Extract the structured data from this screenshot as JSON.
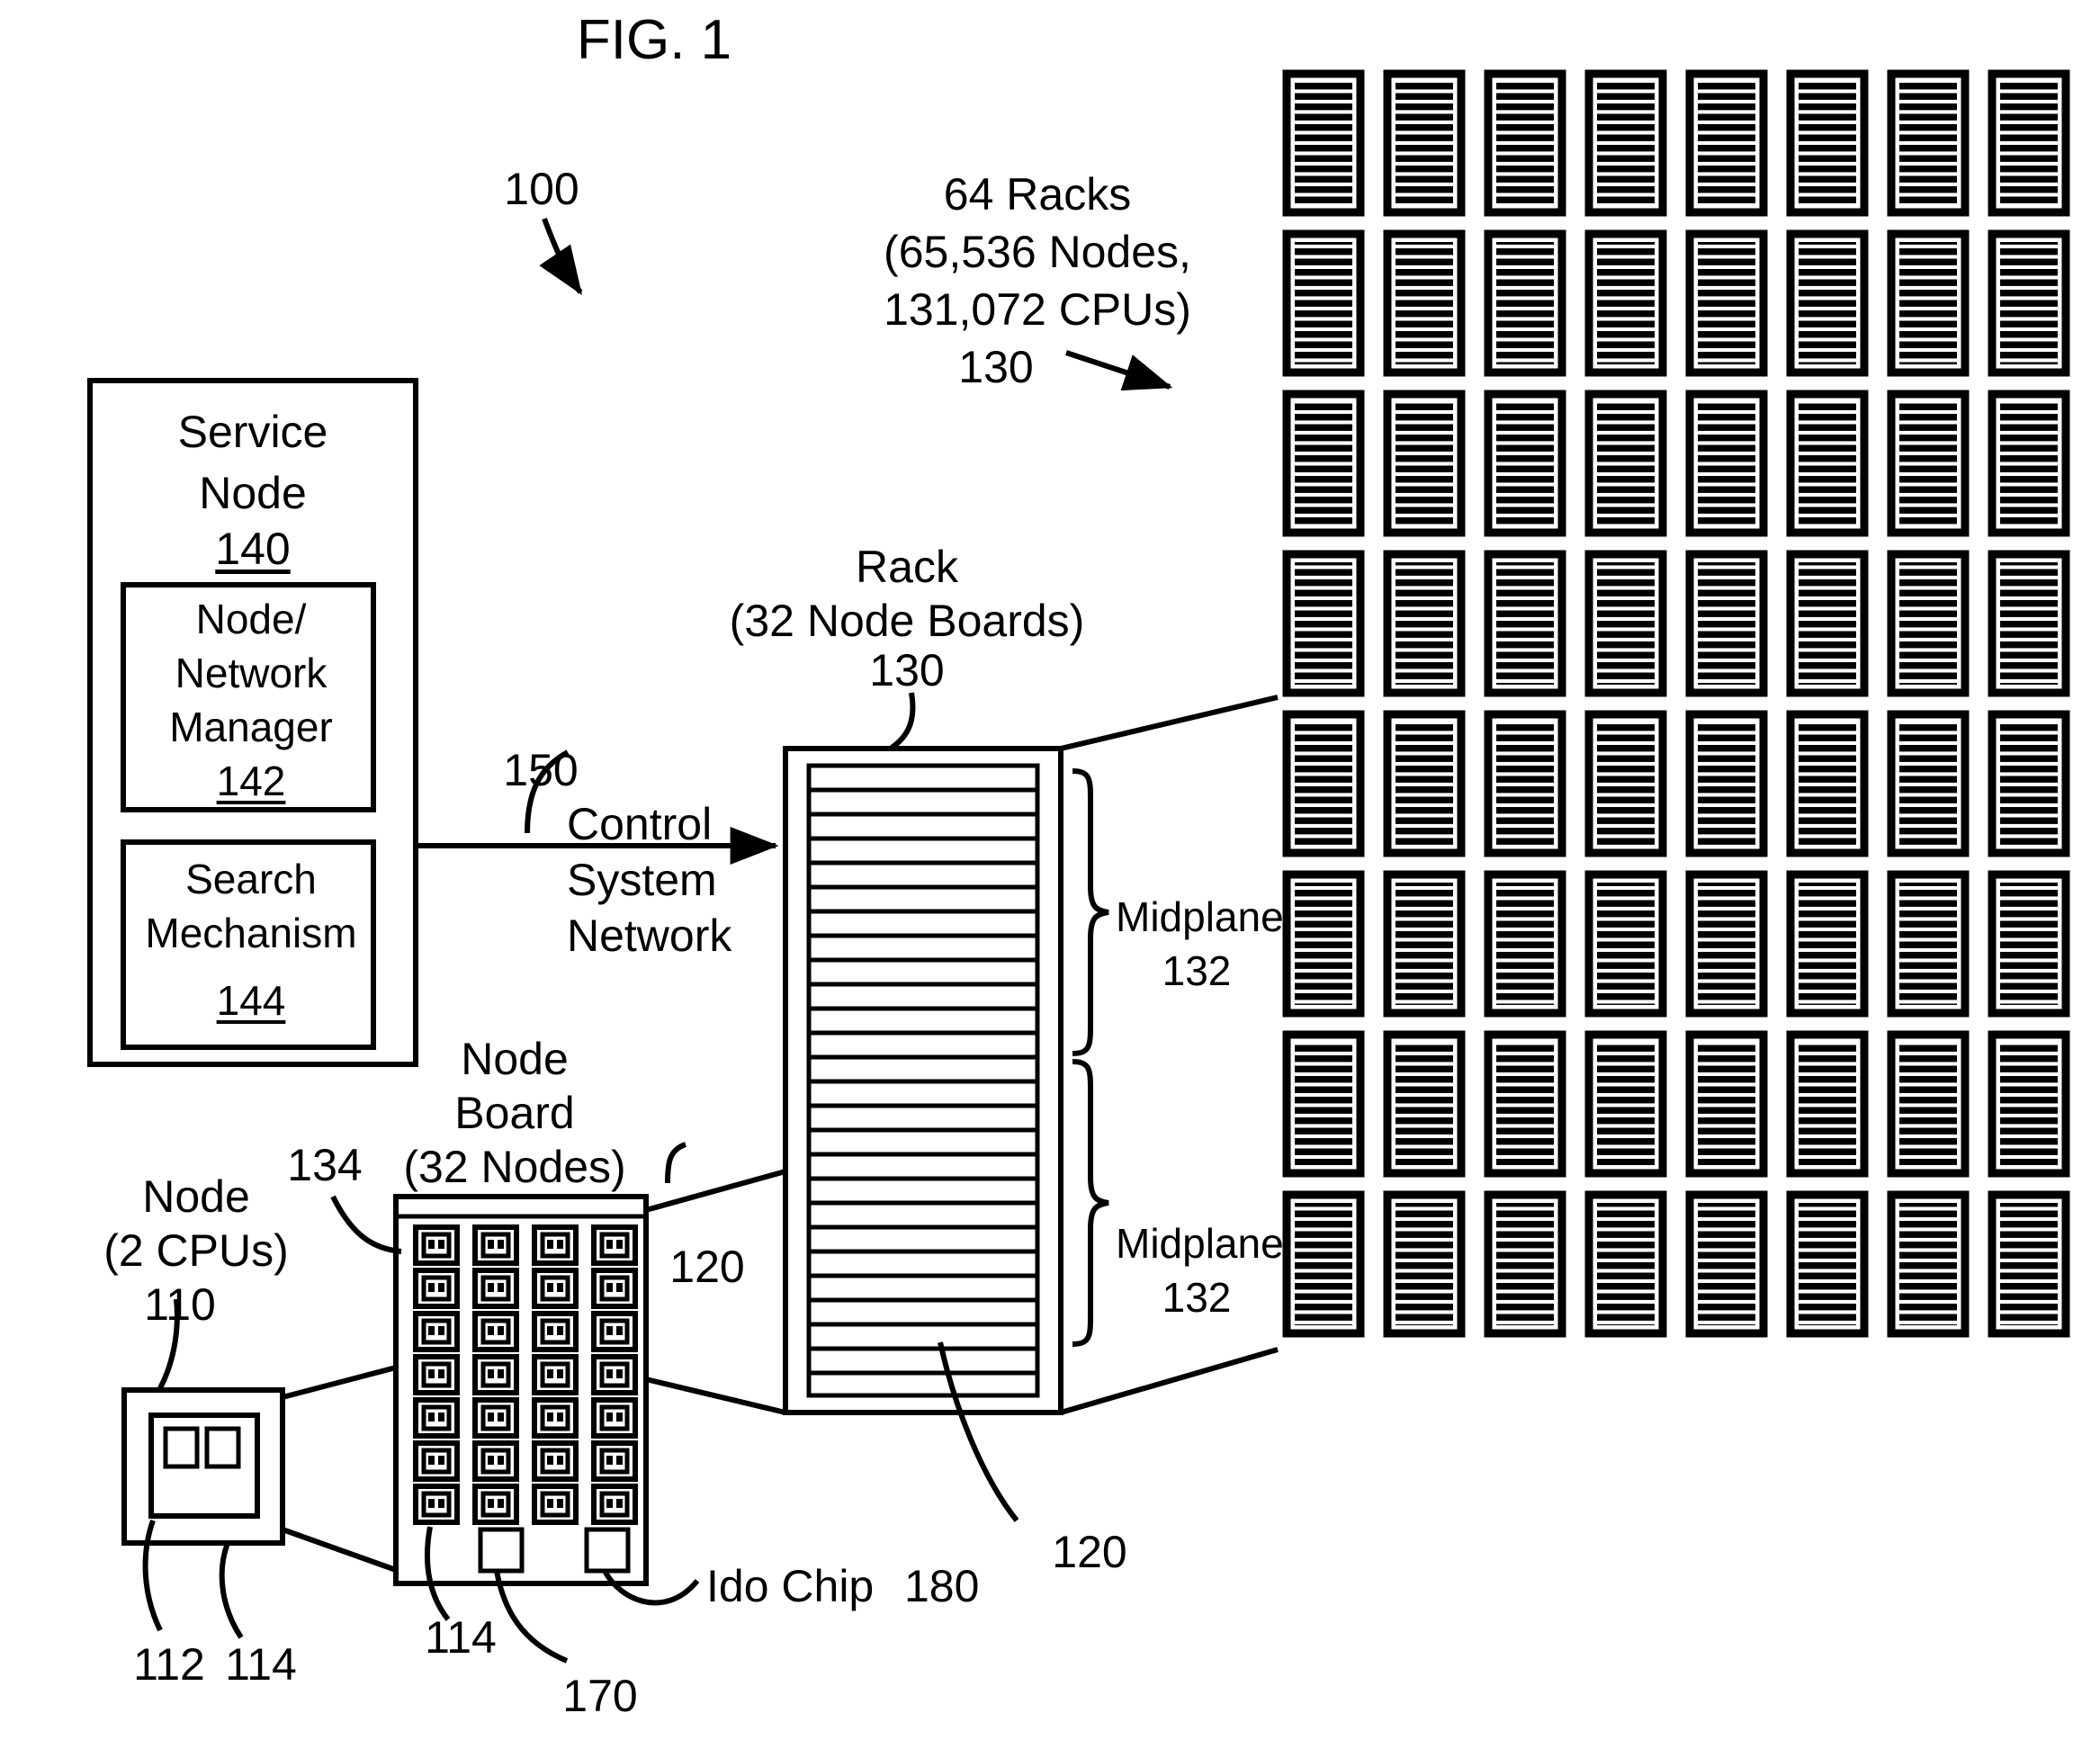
{
  "figure": {
    "title": "FIG. 1",
    "system_ref": "100"
  },
  "service_node": {
    "title_line1": "Service",
    "title_line2": "Node",
    "ref": "140",
    "node_network_manager": {
      "line1": "Node/",
      "line2": "Network",
      "line3": "Manager",
      "ref": "142"
    },
    "search_mechanism": {
      "line1": "Search",
      "line2": "Mechanism",
      "ref": "144"
    }
  },
  "control_system_network": {
    "ref": "150",
    "line1": "Control",
    "line2": "System",
    "line3": "Network"
  },
  "rack": {
    "label_line1": "Rack",
    "label_line2": "(32 Node Boards)",
    "ref": "130",
    "node_board_ref_upper": "120",
    "node_board_ref_lower": "120",
    "midplane_upper": {
      "label": "Midplane",
      "ref": "132"
    },
    "midplane_lower": {
      "label": "Midplane",
      "ref": "132"
    },
    "slot_count": 26
  },
  "rack_array": {
    "label_line1": "64 Racks",
    "label_line2": "(65,536 Nodes,",
    "label_line3": "131,072 CPUs)",
    "ref": "130",
    "columns": 8,
    "rows": 8,
    "stripes_per_rack": 30
  },
  "node_board": {
    "label_line1": "Node",
    "label_line2": "Board",
    "label_line3": "(32 Nodes)",
    "edge_ref": "134",
    "node_ref": "114",
    "ido_chip_ref": "170",
    "ido_chip_label": "Ido Chip",
    "ido_chip_number": "180",
    "grid_columns": 4,
    "grid_rows": 8
  },
  "node_detail": {
    "label_line1": "Node",
    "label_line2": "(2 CPUs)",
    "ref": "110",
    "cpu_ref": "112",
    "node_ref": "114"
  }
}
